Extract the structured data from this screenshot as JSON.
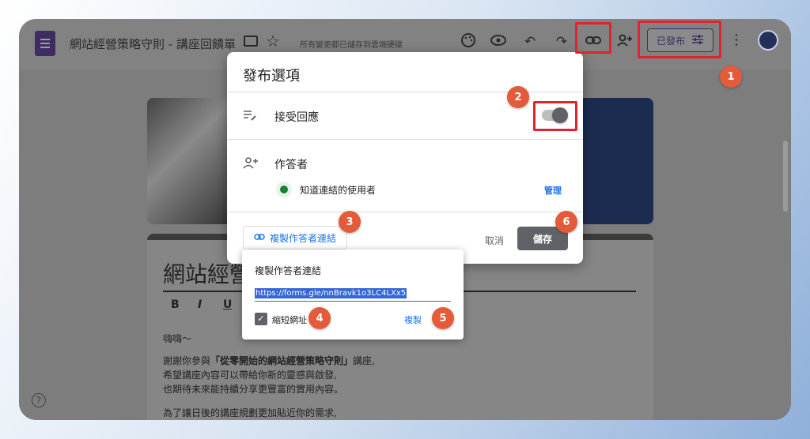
{
  "header": {
    "doc_title": "網站經營策略守則 - 講座回饋單",
    "save_status": "所有變更都已儲存到雲端硬碟",
    "publish_label": "已發布",
    "icons": [
      "palette-icon",
      "preview-icon",
      "undo-icon",
      "redo-icon",
      "link-icon",
      "add-collaborator-icon",
      "more-icon"
    ]
  },
  "dialog": {
    "title": "發布選項",
    "accept_responses_label": "接受回應",
    "accept_responses_on": true,
    "responders_label": "作答者",
    "responders_value": "知道連結的使用者",
    "manage_label": "管理",
    "copy_link_label": "複製作答者連結",
    "cancel_label": "取消",
    "save_label": "儲存"
  },
  "copy_popup": {
    "title": "複製作答者連結",
    "url": "https://forms.gle/nnBravk1o3LC4LXx5",
    "shorten_label": "縮短網址",
    "shorten_checked": true,
    "copy_label": "複製"
  },
  "form": {
    "title_partial": "網站經營",
    "format_tools": [
      "B",
      "I",
      "U"
    ],
    "greeting": "嗨嗨～",
    "line1_prefix": "謝謝你參與",
    "line1_bold": "「從零開始的網站經營策略守則」",
    "line1_suffix": "講座,",
    "line2": "希望講座內容可以帶給你新的靈感與啟發,",
    "line3": "也期待未來能持續分享更豐富的實用內容。",
    "line4": "為了讓日後的講座規劃更加貼近你的需求,"
  },
  "annotations": {
    "steps": [
      "1",
      "2",
      "3",
      "4",
      "5",
      "6"
    ],
    "highlight_color": "#e0232e",
    "badge_color": "#e35b3a"
  }
}
